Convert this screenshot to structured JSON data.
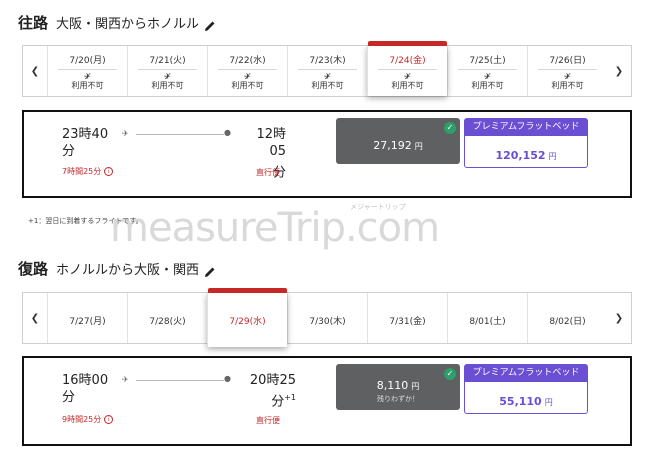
{
  "outbound": {
    "title": "往路",
    "route": "大阪・関西からホノルル",
    "dates": [
      {
        "date": "7/20(月)",
        "status": "利用不可",
        "selected": false
      },
      {
        "date": "7/21(火)",
        "status": "利用不可",
        "selected": false
      },
      {
        "date": "7/22(水)",
        "status": "利用不可",
        "selected": false
      },
      {
        "date": "7/23(木)",
        "status": "利用不可",
        "selected": false
      },
      {
        "date": "7/24(金)",
        "status": "利用不可",
        "selected": true
      },
      {
        "date": "7/25(土)",
        "status": "利用不可",
        "selected": false
      },
      {
        "date": "7/26(日)",
        "status": "利用不可",
        "selected": false
      }
    ],
    "flight": {
      "depart_time_line1": "23時40",
      "depart_time_line2": "分",
      "duration": "7時間25分",
      "arrive_time_line1": "12時05",
      "arrive_time_line2": "分",
      "arrive_suffix": "",
      "direct": "直行便",
      "economy_price": "27,192",
      "economy_note": "",
      "premium_label": "プレミアムフラットベッド",
      "premium_price": "120,152"
    },
    "note": "+1：翌日に到着するフライトです。"
  },
  "inbound": {
    "title": "復路",
    "route": "ホノルルから大阪・関西",
    "dates": [
      {
        "date": "7/27(月)",
        "selected": false
      },
      {
        "date": "7/28(火)",
        "selected": false
      },
      {
        "date": "7/29(水)",
        "selected": true
      },
      {
        "date": "7/30(木)",
        "selected": false
      },
      {
        "date": "7/31(金)",
        "selected": false
      },
      {
        "date": "8/01(土)",
        "selected": false
      },
      {
        "date": "8/02(日)",
        "selected": false
      }
    ],
    "flight": {
      "depart_time_line1": "16時00",
      "depart_time_line2": "分",
      "duration": "9時間25分",
      "arrive_time_line1": "20時25",
      "arrive_time_line2": "分",
      "arrive_suffix": "+1",
      "direct": "直行便",
      "economy_price": "8,110",
      "economy_note": "残りわずか！",
      "premium_label": "プレミアムフラットベッド",
      "premium_price": "55,110"
    }
  },
  "currency": "円",
  "watermark": "measureTrip.com",
  "watermark_sub": "メジャートリップ",
  "icons": {
    "pencil": "pencil-icon",
    "plane": "plane-icon",
    "pin": "location-pin-icon",
    "check": "check-icon",
    "info": "info-icon"
  },
  "colors": {
    "accent_red": "#c62828",
    "premium_purple": "#6a4fd3",
    "economy_gray": "#5f6062",
    "check_green": "#2e9e6b"
  }
}
